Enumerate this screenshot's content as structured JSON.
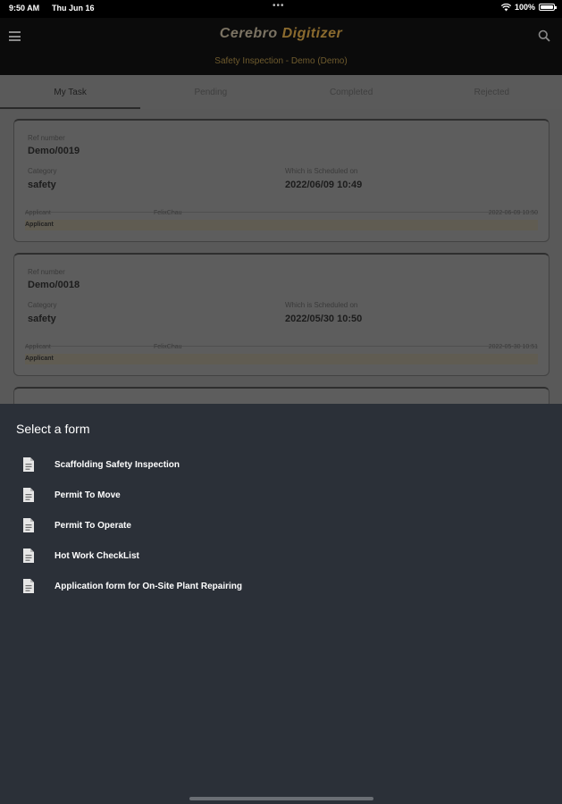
{
  "status_bar": {
    "time": "9:50 AM",
    "date": "Thu Jun 16",
    "dots": "•••",
    "battery": "100%",
    "wifi_icon": "wifi-icon",
    "battery_icon": "battery-icon"
  },
  "header": {
    "title_part1": "Cerebro ",
    "title_part2": "Digitizer",
    "subtitle": "Safety Inspection - Demo (Demo)",
    "menu_icon": "menu-icon",
    "search_icon": "search-icon"
  },
  "tabs": [
    {
      "label": "My Task",
      "active": true
    },
    {
      "label": "Pending",
      "active": false
    },
    {
      "label": "Completed",
      "active": false
    },
    {
      "label": "Rejected",
      "active": false
    }
  ],
  "cards": [
    {
      "ref_label": "Ref number",
      "ref": "Demo/0019",
      "category_label": "Category",
      "category": "safety",
      "scheduled_label": "Which is Scheduled on",
      "scheduled": "2022/06/09 10:49",
      "applicant_label": "Applicant",
      "applicant_name": "FelixChau",
      "applicant_date": "2022-06-09 10:50",
      "role": "Applicant"
    },
    {
      "ref_label": "Ref number",
      "ref": "Demo/0018",
      "category_label": "Category",
      "category": "safety",
      "scheduled_label": "Which is Scheduled on",
      "scheduled": "2022/05/30 10:50",
      "applicant_label": "Applicant",
      "applicant_name": "FelixChau",
      "applicant_date": "2022-05-30 10:51",
      "role": "Applicant"
    }
  ],
  "sheet": {
    "title": "Select a form",
    "items": [
      {
        "label": "Scaffolding Safety Inspection",
        "icon": "document-icon"
      },
      {
        "label": "Permit To Move",
        "icon": "document-icon"
      },
      {
        "label": "Permit To Operate",
        "icon": "document-icon"
      },
      {
        "label": "Hot Work CheckList",
        "icon": "document-icon"
      },
      {
        "label": "Application form for On-Site Plant Repairing",
        "icon": "document-icon"
      }
    ]
  },
  "colors": {
    "sheet_background": "#2b3038",
    "header_background": "#0b0b0b",
    "brand_accent": "#8a6a2e"
  }
}
